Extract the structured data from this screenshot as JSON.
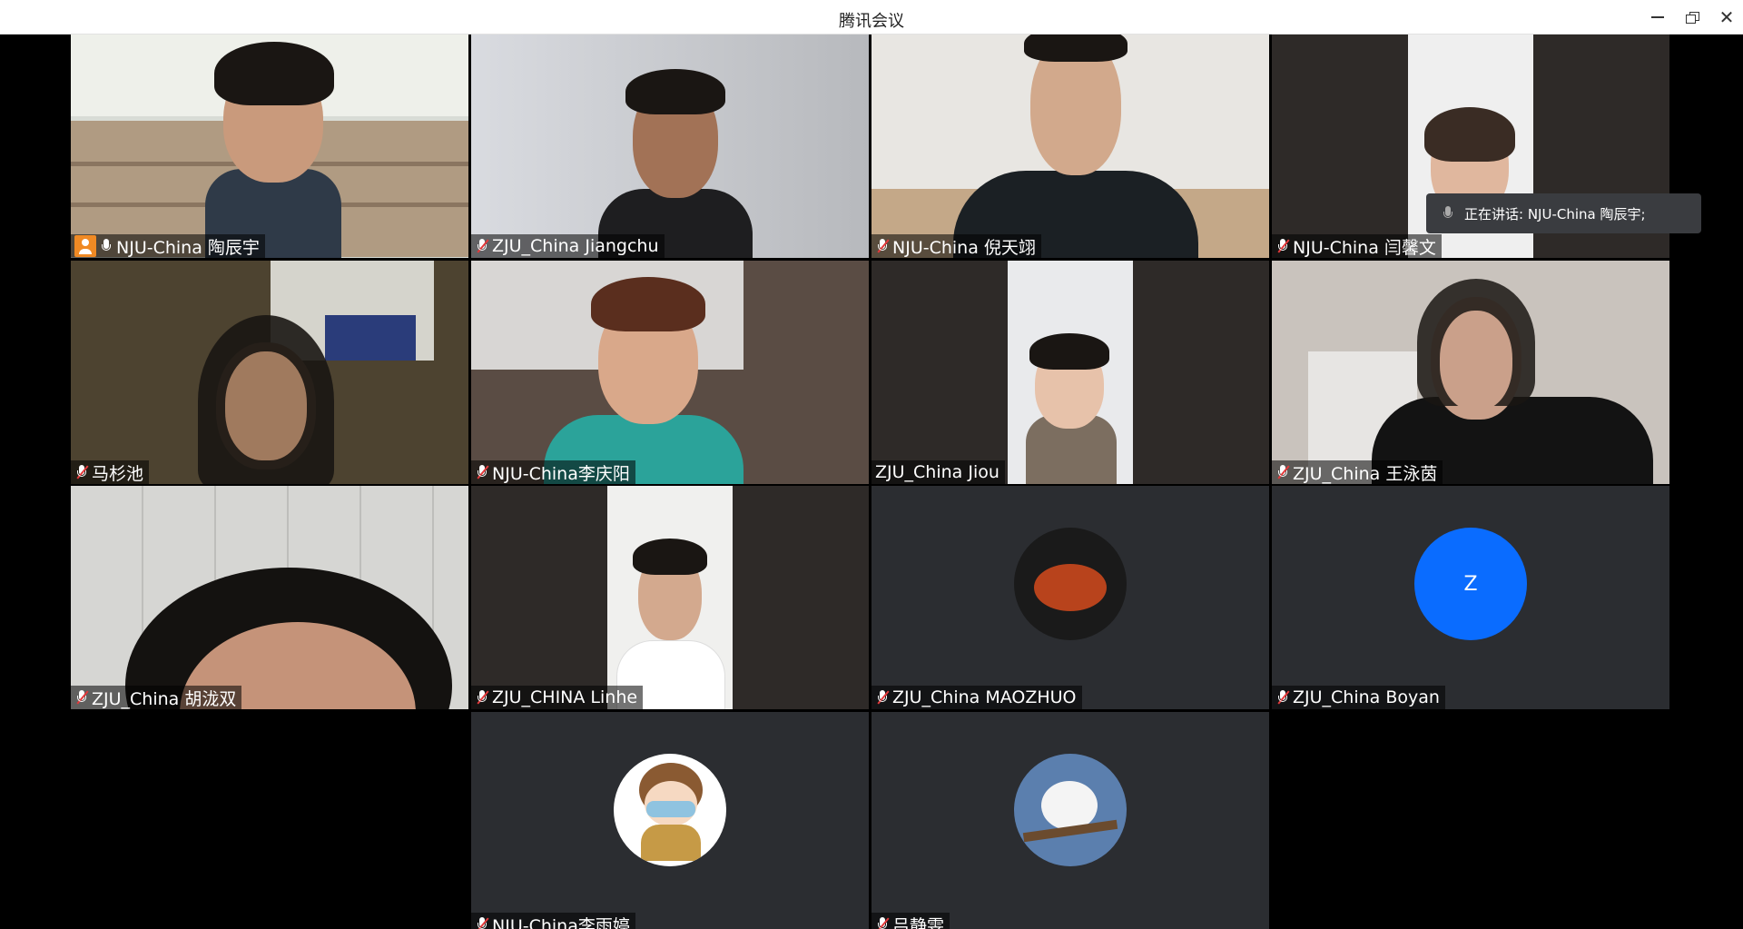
{
  "window": {
    "title": "腾讯会议"
  },
  "speaking": {
    "text": "正在讲话: NJU-China 陶辰宇;"
  },
  "participants": [
    {
      "name": "NJU-China 陶辰宇",
      "muted": false,
      "host": true,
      "active": true
    },
    {
      "name": "ZJU_China Jiangchu",
      "muted": true
    },
    {
      "name": "NJU-China 倪天翊",
      "muted": true
    },
    {
      "name": "NJU-China 闫馨文",
      "muted": true
    },
    {
      "name": "马杉池",
      "muted": true
    },
    {
      "name": "NJU-China李庆阳",
      "muted": true
    },
    {
      "name": "ZJU_China Jiou",
      "muted": false,
      "no_mic_icon": true
    },
    {
      "name": "ZJU_China 王泳茵",
      "muted": true
    },
    {
      "name": "ZJU_China 胡泷双",
      "muted": true
    },
    {
      "name": "ZJU_CHINA Linhe",
      "muted": true
    },
    {
      "name": "ZJU_China MAOZHUO",
      "muted": true
    },
    {
      "name": "ZJU_China Boyan",
      "muted": true,
      "avatar_letter": "Z"
    },
    {
      "name": "NJU-China李雨婷",
      "muted": true
    },
    {
      "name": "吕静雯",
      "muted": true
    }
  ],
  "colors": {
    "active_border": "#22b573",
    "letter_avatar": "#0a6cff",
    "host_badge": "#f08a24",
    "muted_red": "#e5393b"
  }
}
